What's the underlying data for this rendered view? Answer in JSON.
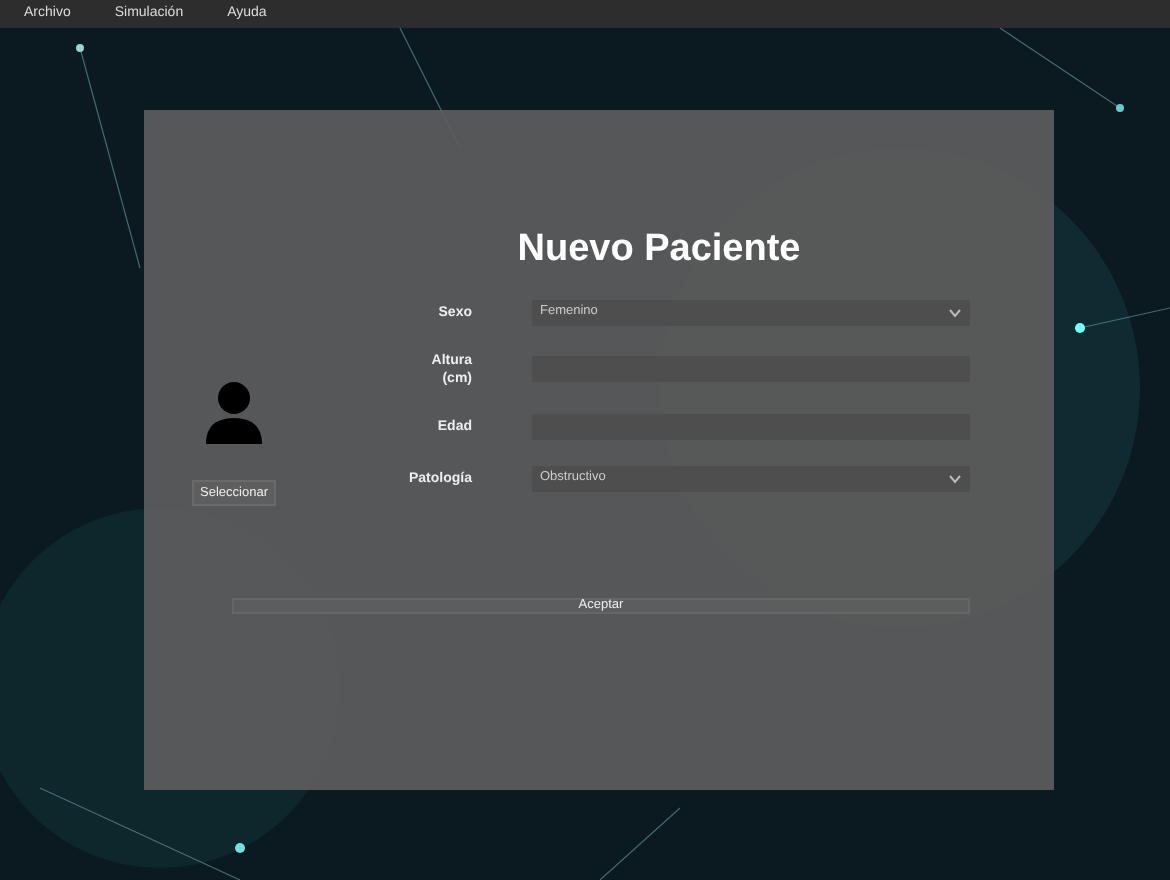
{
  "menu_bar": {
    "items": [
      "Archivo",
      "Simulación",
      "Ayuda"
    ]
  },
  "dialog": {
    "title": "Nuevo Paciente",
    "photo_button": "Seleccionar",
    "fields": [
      {
        "kind": "select",
        "label": "Sexo",
        "value": "Femenino"
      },
      {
        "kind": "input",
        "label": "Altura\n(cm)"
      },
      {
        "kind": "input",
        "label": "Edad"
      },
      {
        "kind": "select",
        "label": "Patología",
        "value": "Obstructivo"
      }
    ],
    "submit_button": "Aceptar"
  }
}
